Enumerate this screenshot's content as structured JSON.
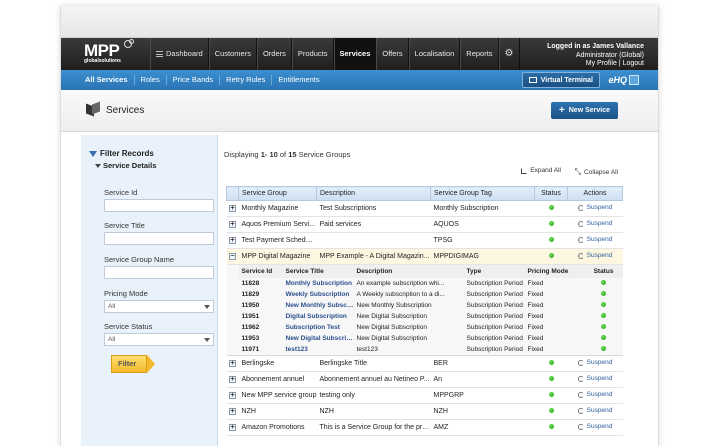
{
  "header": {
    "logo_text": "MPP",
    "logo_sub": "globalsolutions",
    "nav": [
      {
        "label": "Dashboard",
        "icon": "hamburger-icon"
      },
      {
        "label": "Customers"
      },
      {
        "label": "Orders"
      },
      {
        "label": "Products"
      },
      {
        "label": "Services",
        "active": true
      },
      {
        "label": "Offers"
      },
      {
        "label": "Localisation"
      },
      {
        "label": "Reports"
      }
    ],
    "user": {
      "logged_in": "Logged in as James Vallance",
      "role": "Administrator (Global)",
      "links": "My Profile | Logout"
    }
  },
  "subnav": {
    "items": [
      "All Services",
      "Roles",
      "Price Bands",
      "Retry Rules",
      "Entitlements"
    ],
    "virtual_terminal": "Virtual Terminal",
    "ehq": "eHQ"
  },
  "page": {
    "title": "Services",
    "new_button": "New Service"
  },
  "filter": {
    "title": "Filter Records",
    "section": "Service Details",
    "fields": {
      "service_id": "Service Id",
      "service_title": "Service Title",
      "service_group_name": "Service Group Name",
      "pricing_mode": "Pricing Mode",
      "pricing_mode_value": "All",
      "service_status": "Service Status",
      "service_status_value": "All"
    },
    "button": "Filter"
  },
  "listing": {
    "display_prefix": "Displaying ",
    "display_range": "1- 10",
    "display_of": " of ",
    "display_total": "15",
    "display_suffix": " Service Groups",
    "expand_all": "Expand All",
    "collapse_all": "Collapse All",
    "columns": [
      "Service Group",
      "Description",
      "Service Group Tag",
      "Status",
      "Actions"
    ],
    "action_label": "Suspend",
    "rows_before": [
      {
        "group": "Monthly Magazine",
        "desc": "Test Subscriptions",
        "tag": "Monthly Subscription"
      },
      {
        "group": "Aquos Premium Servi...",
        "desc": "Paid services",
        "tag": "AQUOS"
      },
      {
        "group": "Test Payment Schedul...",
        "desc": "",
        "tag": "TPSG"
      }
    ],
    "expanded_row": {
      "group": "MPP Digital Magazine",
      "desc": "MPP Example - A Digital Magazin...",
      "tag": "MPPDIGIMAG"
    },
    "sub_columns": [
      "Service Id",
      "Service Title",
      "Description",
      "Type",
      "Pricing Mode",
      "Status"
    ],
    "sub_rows": [
      {
        "id": "11828",
        "title": "Monthly Subscription",
        "desc": "An example subscription whi...",
        "type": "Subscription Period",
        "mode": "Fixed"
      },
      {
        "id": "11829",
        "title": "Weekly Subscription",
        "desc": "A Weekly subscription to a di...",
        "type": "Subscription Period",
        "mode": "Fixed"
      },
      {
        "id": "11950",
        "title": "New Monthly Subscript...",
        "desc": "New Monthly Subscription",
        "type": "Subscription Period",
        "mode": "Fixed"
      },
      {
        "id": "11951",
        "title": "Digital Subscription",
        "desc": "New Digital Subscription",
        "type": "Subscription Period",
        "mode": "Fixed"
      },
      {
        "id": "11962",
        "title": "Subscription Test",
        "desc": "New Digital Subscription",
        "type": "Subscription Period",
        "mode": "Fixed"
      },
      {
        "id": "11953",
        "title": "New Digital Subscription",
        "desc": "New Digital Subscription",
        "type": "Subscription Period",
        "mode": "Fixed"
      },
      {
        "id": "11971",
        "title": "test123",
        "desc": "test123",
        "type": "Subscription Period",
        "mode": "Fixed"
      }
    ],
    "rows_after": [
      {
        "group": "Berlingske",
        "desc": "Berlingske Title",
        "tag": "BER"
      },
      {
        "group": "Abonnement annuel",
        "desc": "Abonnement annuel au Netineo P...",
        "tag": "An"
      },
      {
        "group": "New MPP service group",
        "desc": "testing only",
        "tag": "MPPGRP"
      },
      {
        "group": "NZH",
        "desc": "NZH",
        "tag": "NZH"
      },
      {
        "group": "Amazon Promotions",
        "desc": "This is a Service Group for the pro...",
        "tag": "AMZ"
      }
    ]
  },
  "colors": {
    "nav_bg": "#1f1f1f",
    "subnav_bg": "#2a74b4",
    "sidebar_bg": "#e9f1fb",
    "status_active": "#1f9a12",
    "filter_button": "#f3b92c"
  }
}
